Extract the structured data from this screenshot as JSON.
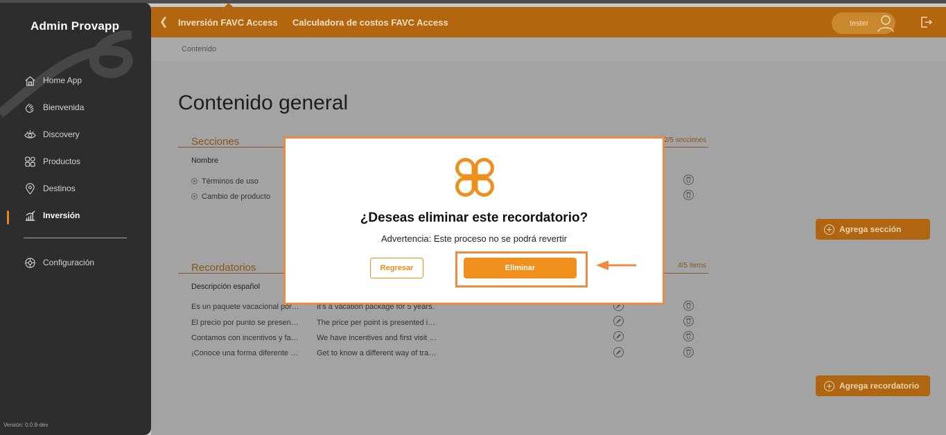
{
  "sidebar": {
    "brand": "Admin Provapp",
    "items": [
      {
        "label": "Home App",
        "icon": "home-icon"
      },
      {
        "label": "Bienvenida",
        "icon": "waving-hand-icon"
      },
      {
        "label": "Discovery",
        "icon": "eye-icon"
      },
      {
        "label": "Productos",
        "icon": "grid-icon"
      },
      {
        "label": "Destinos",
        "icon": "location-pin-icon"
      },
      {
        "label": "Inversión",
        "icon": "bar-chart-icon",
        "active": true
      },
      {
        "label": "Configuración",
        "icon": "settings-icon"
      }
    ],
    "version": "Versión: 0.0.9-dev"
  },
  "header": {
    "crumb1": "Inversión FAVC Access",
    "crumb2": "Calculadora de costos FAVC Access",
    "user": "tester"
  },
  "subheader": {
    "label": "Contenido"
  },
  "main": {
    "title": "Contenido general",
    "sections": {
      "title": "Secciones",
      "count": "2/5 secciones",
      "column": "Nombre",
      "rows": [
        "Términos de uso",
        "Cambio de producto"
      ],
      "add_button": "Agrega sección"
    },
    "reminders": {
      "title": "Recordatorios",
      "count": "4/5 ítems",
      "column": "Descripción español",
      "rows": [
        {
          "es": "Es un paquete vacacional por…",
          "en": "It's a vacation package for 5 years."
        },
        {
          "es": "El precio por punto se presen…",
          "en": "The price per point is presented i…"
        },
        {
          "es": "Contamos con incentivos y fa…",
          "en": "We have incentives and first visit …"
        },
        {
          "es": "¡Conoce una forma diferente …",
          "en": "Get to know a different way of tra…"
        }
      ],
      "add_button": "Agrega recordatorio"
    }
  },
  "modal": {
    "title": "¿Deseas eliminar este recordatorio?",
    "warning": "Advertencia: Este proceso no se podrá revertir",
    "cancel": "Regresar",
    "confirm": "Eliminar"
  },
  "colors": {
    "accent": "#f0901c",
    "highlight": "#f08a3c",
    "sidebar": "#2d2d2d"
  }
}
